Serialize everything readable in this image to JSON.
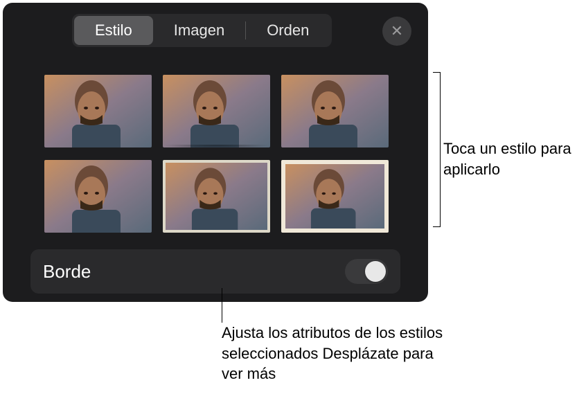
{
  "tabs": {
    "style": "Estilo",
    "image": "Imagen",
    "order": "Orden"
  },
  "close_label": "✕",
  "border": {
    "label": "Borde",
    "enabled": false
  },
  "callouts": {
    "right": "Toca un estilo para aplicarlo",
    "bottom": "Ajusta los atributos de los estilos seleccionados Desplázate para ver más"
  },
  "style_tiles": [
    {
      "id": "style-plain"
    },
    {
      "id": "style-shadow"
    },
    {
      "id": "style-reflection"
    },
    {
      "id": "style-frame-dark"
    },
    {
      "id": "style-frame-thin"
    },
    {
      "id": "style-frame-white"
    }
  ]
}
